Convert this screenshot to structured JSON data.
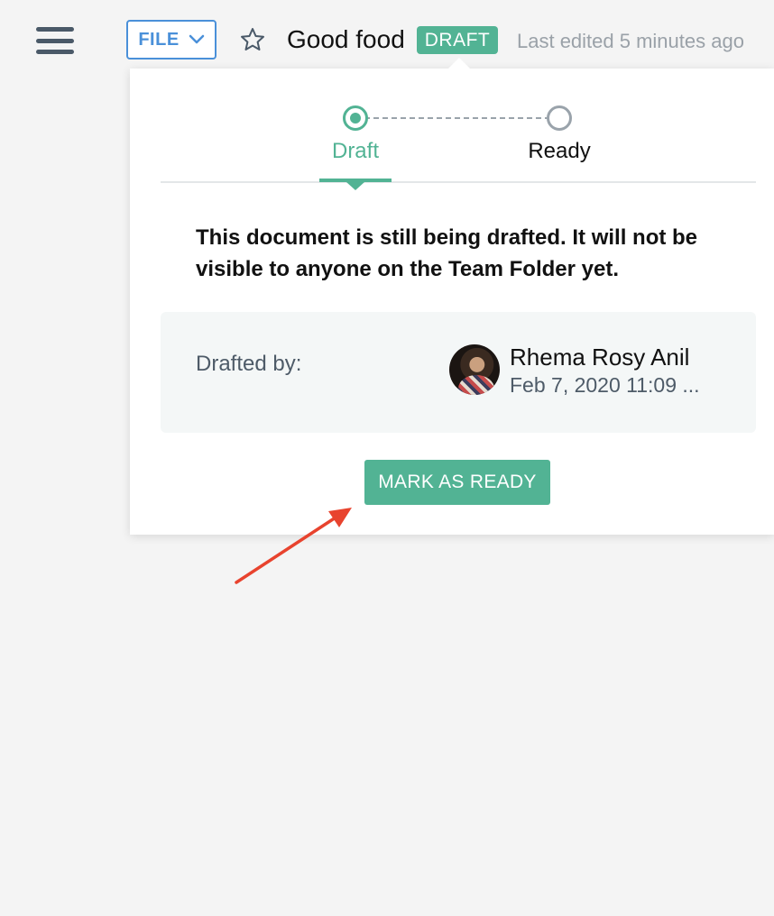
{
  "header": {
    "file_label": "FILE",
    "doc_title": "Good food",
    "status_badge": "DRAFT",
    "last_edited": "Last edited 5 minutes ago"
  },
  "popover": {
    "steps": [
      {
        "label": "Draft",
        "active": true
      },
      {
        "label": "Ready",
        "active": false
      }
    ],
    "description": "This document is still being drafted. It will not be visible to anyone on the Team Folder yet.",
    "drafted_by_label": "Drafted by:",
    "author": {
      "name": "Rhema Rosy Anil",
      "date": "Feb 7, 2020 11:09 ..."
    },
    "action_label": "MARK AS READY"
  },
  "colors": {
    "accent": "#52b394",
    "file_blue": "#4a90d9",
    "annotation": "#e8432e"
  },
  "icons": {
    "menu": "hamburger-menu-icon",
    "file_dropdown": "chevron-down-icon",
    "star": "star-outline-icon",
    "annotation": "red-arrow"
  }
}
